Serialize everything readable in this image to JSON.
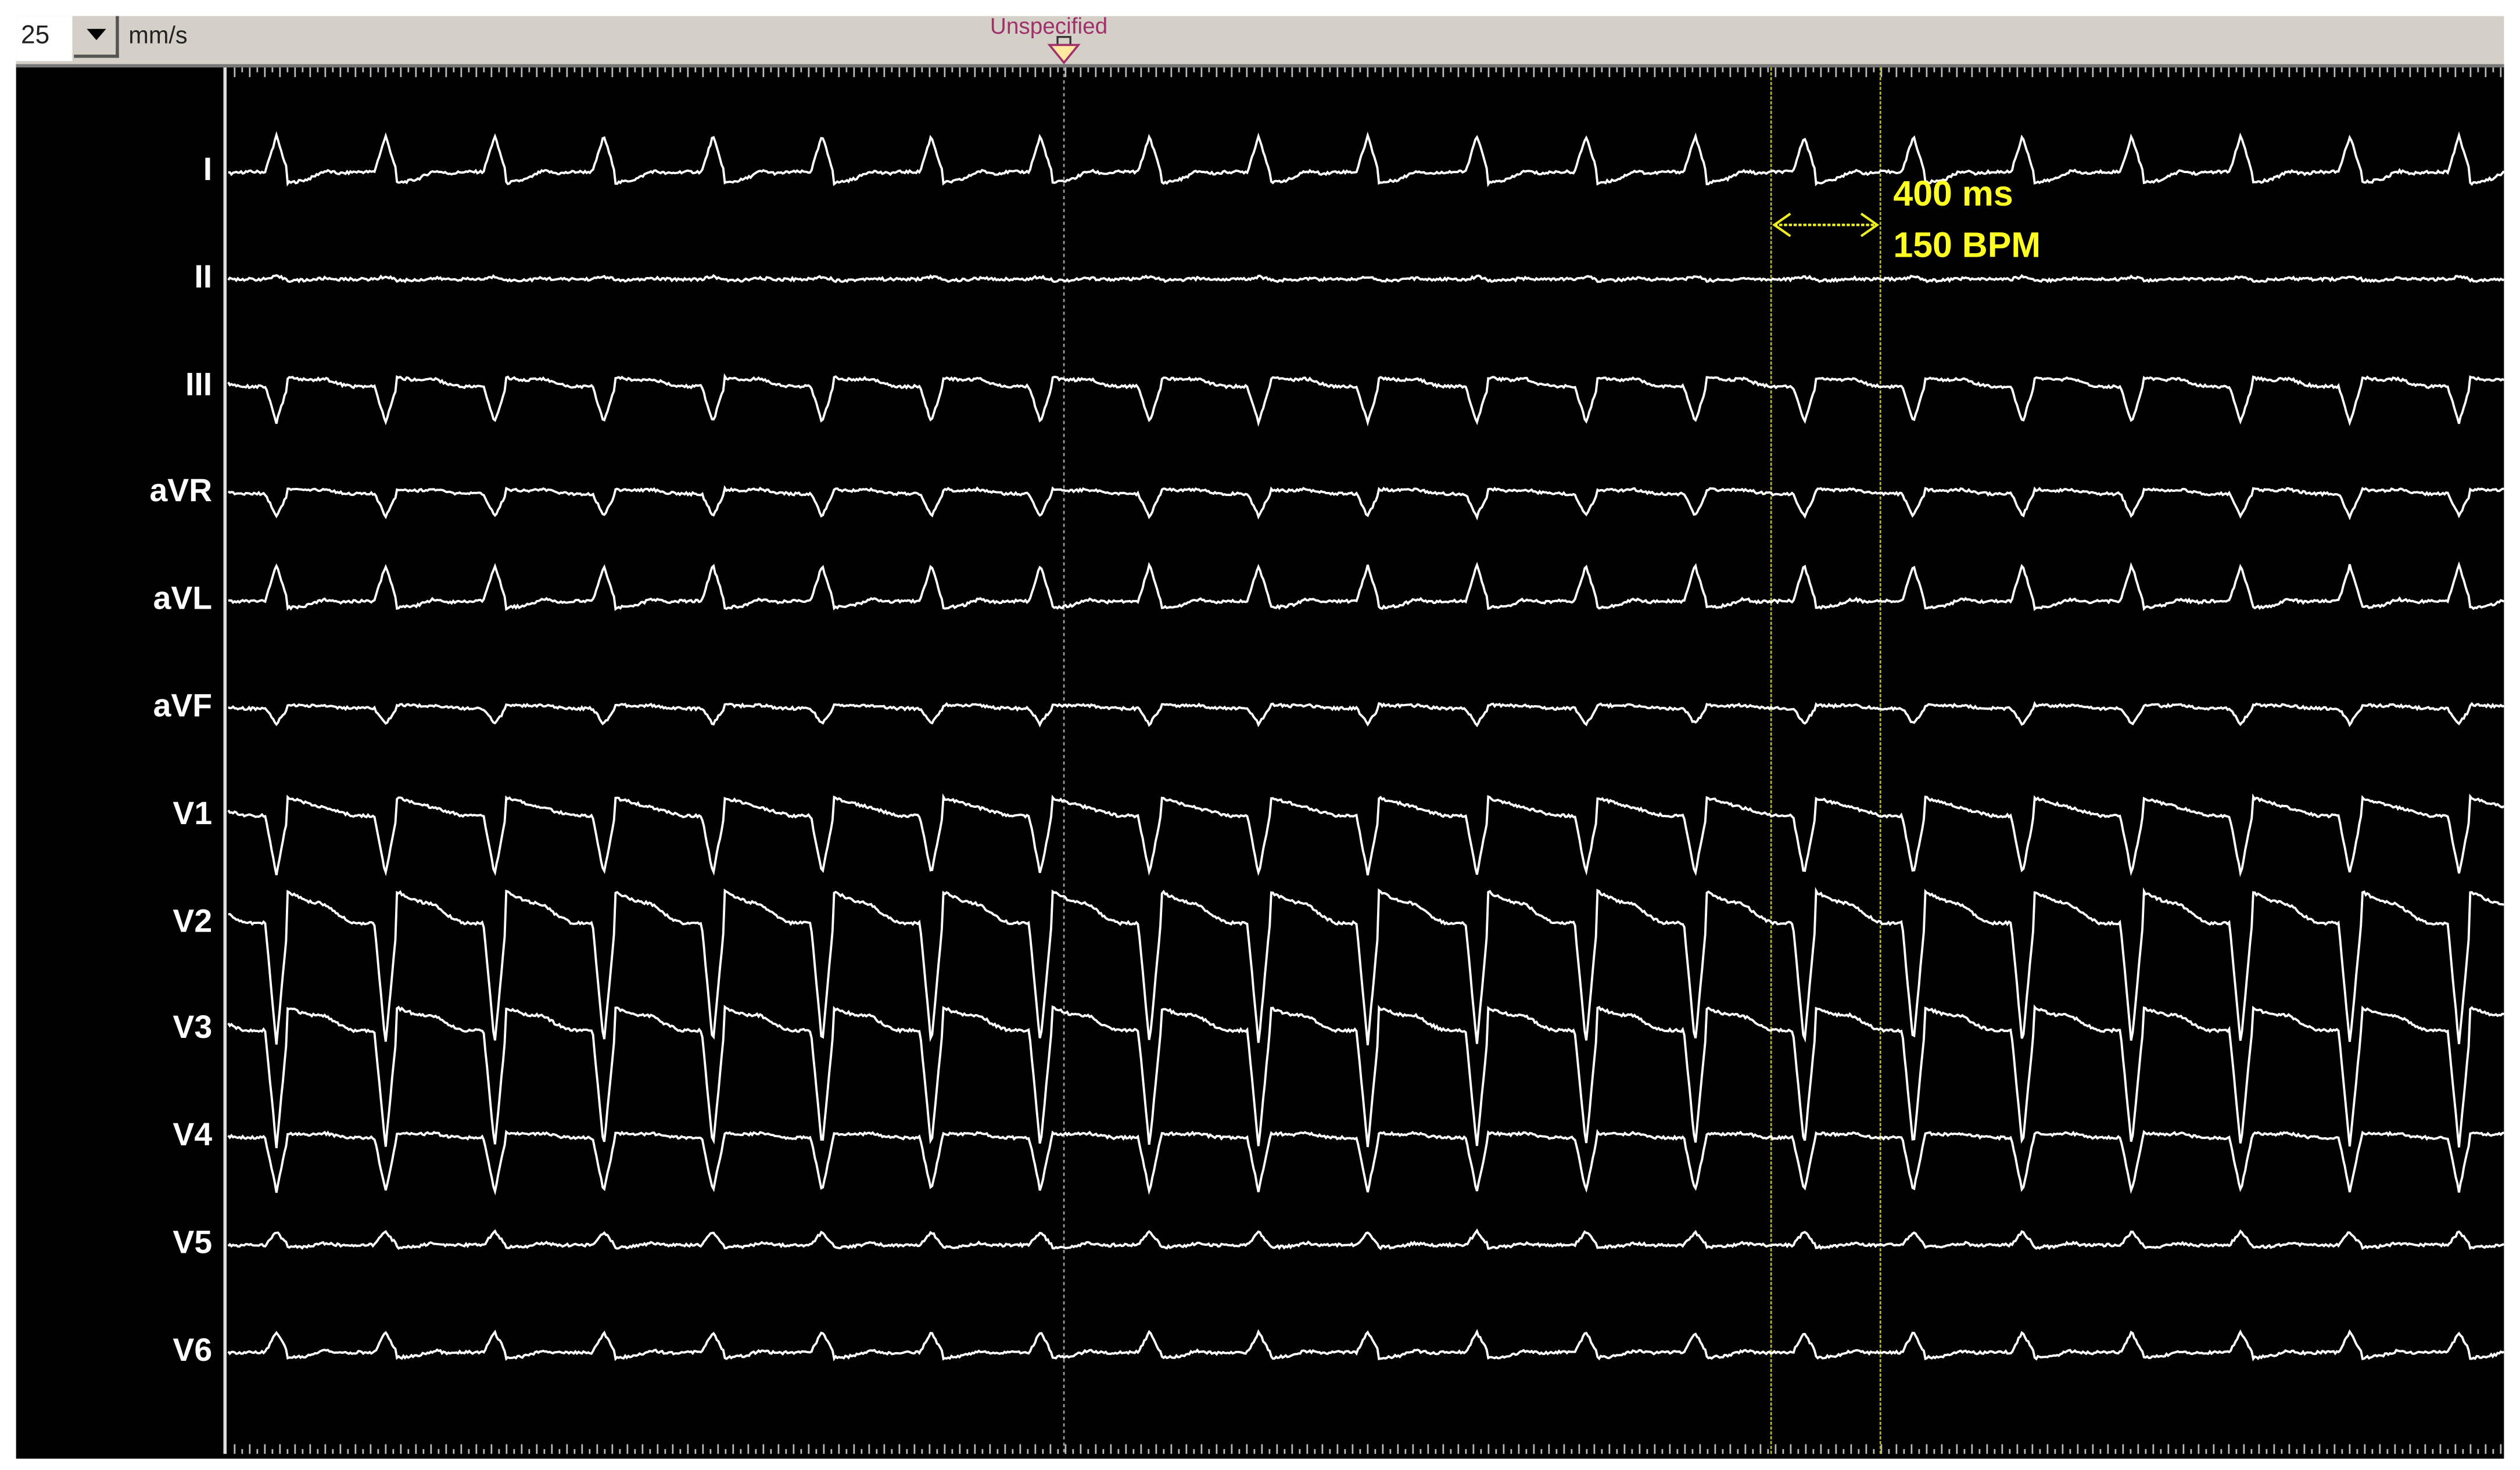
{
  "toolbar": {
    "speed_value": "25",
    "speed_unit": "mm/s",
    "dropdown_icon": "chevron-down-icon"
  },
  "event_marker": {
    "label": "Unspecified",
    "icon": "triangle-down-marker-icon"
  },
  "measurement": {
    "interval": "400 ms",
    "rate": "150 BPM",
    "color": "#ffff22"
  },
  "colors": {
    "background": "#000000",
    "trace": "#ffffff",
    "toolbar": "#d4d0c8",
    "marker_label": "#a0306a"
  },
  "leads": [
    {
      "name": "I",
      "qrs": 0.8,
      "st": -0.25,
      "t": 0.12
    },
    {
      "name": "II",
      "qrs": 0.06,
      "st": -0.03,
      "t": 0.03
    },
    {
      "name": "III",
      "qrs": -0.8,
      "st": 0.2,
      "t": 0.08
    },
    {
      "name": "aVR",
      "qrs": -0.5,
      "st": 0.1,
      "t": 0.05
    },
    {
      "name": "aVL",
      "qrs": 0.8,
      "st": -0.15,
      "t": 0.1
    },
    {
      "name": "aVF",
      "qrs": -0.35,
      "st": 0.08,
      "t": 0.03
    },
    {
      "name": "V1",
      "qrs": -1.3,
      "st": 0.4,
      "t": 0.0
    },
    {
      "name": "V2",
      "qrs": -2.7,
      "st": 0.7,
      "t": 0.1
    },
    {
      "name": "V3",
      "qrs": -2.6,
      "st": 0.5,
      "t": 0.1
    },
    {
      "name": "V4",
      "qrs": -1.2,
      "st": 0.1,
      "t": 0.05
    },
    {
      "name": "V5",
      "qrs": 0.3,
      "st": -0.05,
      "t": 0.06
    },
    {
      "name": "V6",
      "qrs": 0.45,
      "st": -0.12,
      "t": 0.08
    }
  ]
}
